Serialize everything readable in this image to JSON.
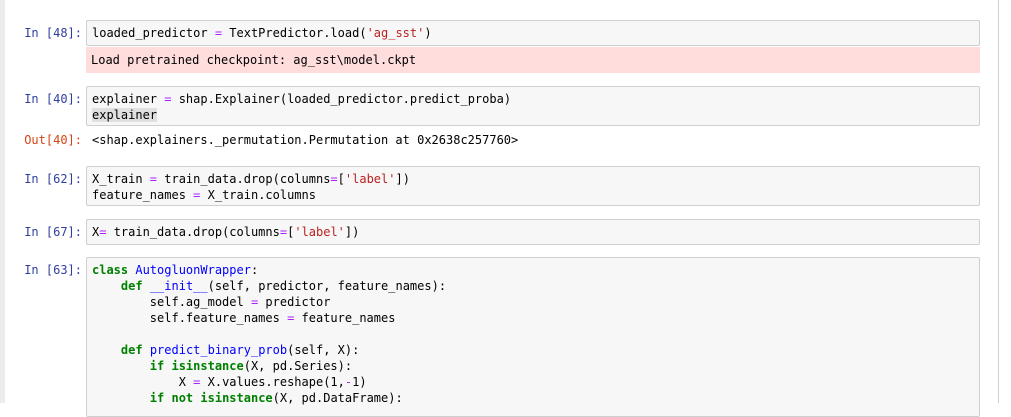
{
  "cells": [
    {
      "prompt": "In [48]:",
      "code": {
        "a": "loaded_predictor ",
        "eq": "=",
        "b": " TextPredictor.load(",
        "str": "'ag_sst'",
        "c": ")"
      },
      "stderr": "Load pretrained checkpoint: ag_sst\\model.ckpt"
    },
    {
      "prompt": "In [40]:",
      "code": {
        "line1_a": "explainer ",
        "line1_eq": "=",
        "line1_b": " shap.Explainer(loaded_predictor.predict_proba)",
        "line2": "explainer"
      },
      "out_prompt": "Out[40]:",
      "output": "<shap.explainers._permutation.Permutation at 0x2638c257760>"
    },
    {
      "prompt": "In [62]:",
      "code": {
        "line1_a": "X_train ",
        "line1_eq": "=",
        "line1_b": " train_data.drop(columns",
        "line1_eq2": "=",
        "line1_c": "[",
        "line1_str": "'label'",
        "line1_d": "])",
        "line2_a": "feature_names ",
        "line2_eq": "=",
        "line2_b": " X_train.columns"
      }
    },
    {
      "prompt": "In [67]:",
      "code": {
        "a": "X",
        "eq": "=",
        "b": " train_data.drop(columns",
        "eq2": "=",
        "c": "[",
        "str": "'label'",
        "d": "])"
      }
    },
    {
      "prompt": "In [63]:",
      "code": {
        "l1_kw": "class",
        "l1_name": "AutogluonWrapper",
        "l1_rest": ":",
        "l2_kw": "def",
        "l2_name": "__init__",
        "l2_rest": "(self, predictor, feature_names):",
        "l3_a": "self.ag_model ",
        "l3_eq": "=",
        "l3_b": " predictor",
        "l4_a": "self.feature_names ",
        "l4_eq": "=",
        "l4_b": " feature_names",
        "l6_kw": "def",
        "l6_name": "predict_binary_prob",
        "l6_rest": "(self, X):",
        "l7_kw": "if",
        "l7_bi": "isinstance",
        "l7_rest": "(X, pd.Series):",
        "l8_a": "X ",
        "l8_eq": "=",
        "l8_b": " X.values.reshape(1,",
        "l8_op": "-",
        "l8_c": "1)",
        "l9_kw": "if",
        "l9_kw2": "not",
        "l9_bi": "isinstance",
        "l9_rest": "(X, pd.DataFrame):"
      }
    }
  ],
  "colors": {
    "prompt_in": "#303f9f",
    "prompt_out": "#d84315",
    "stderr_bg": "#ffdddd",
    "keyword": "#008000",
    "string": "#ba2121",
    "name": "#0000ff",
    "operator": "#aa22ff"
  }
}
